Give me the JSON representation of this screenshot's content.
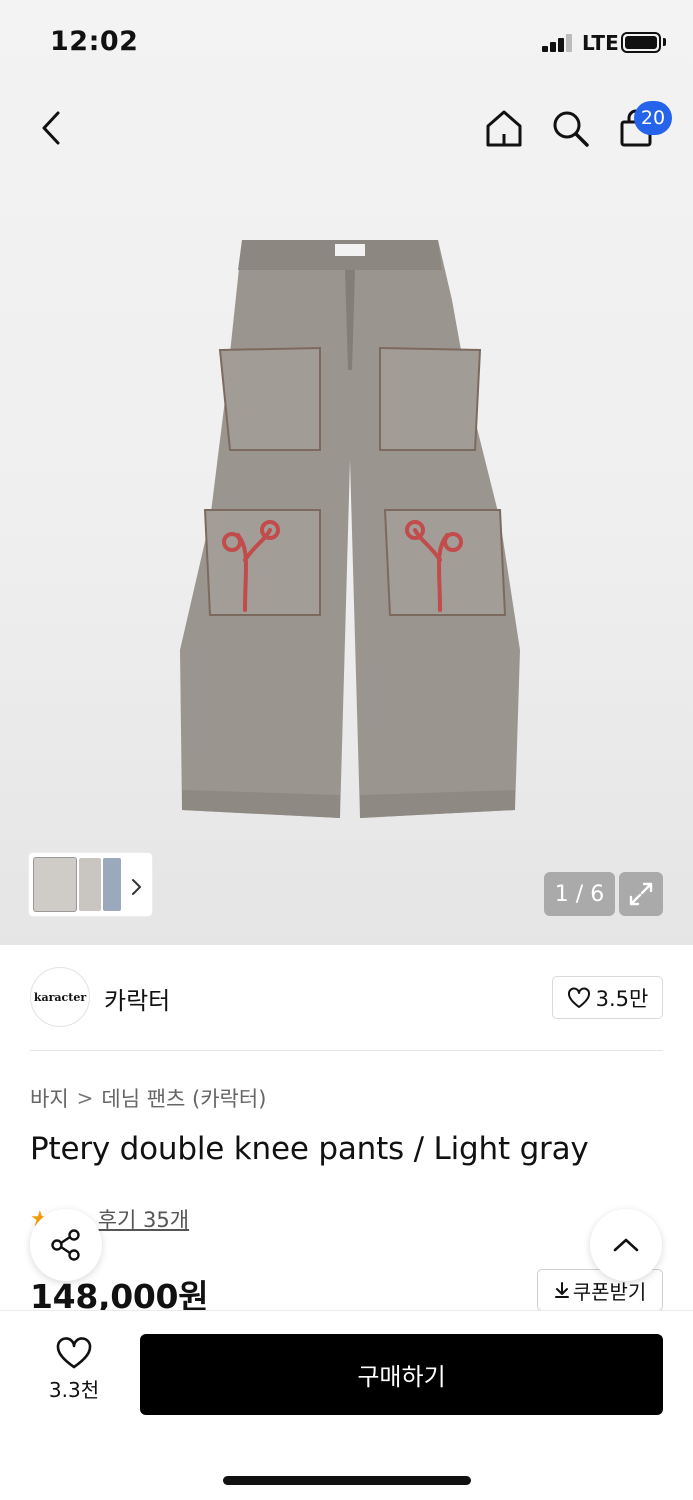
{
  "status_bar": {
    "time": "12:02",
    "network": "LTE"
  },
  "nav": {
    "cart_count": "20"
  },
  "gallery": {
    "counter": "1 / 6"
  },
  "brand": {
    "logo_text": "karacter",
    "name": "카락터",
    "like_count": "3.5만"
  },
  "breadcrumb": {
    "category": "바지",
    "separator": ">",
    "subcategory": "데님 팬츠 (카락터)"
  },
  "product": {
    "title": "Ptery double knee pants / Light gray",
    "review_link": "후기 35개",
    "price": "148,000원",
    "coupon_label": "쿠폰받기"
  },
  "bottom_bar": {
    "wish_count": "3.3천",
    "buy_label": "구매하기"
  },
  "colors": {
    "badge_blue": "#2563eb",
    "star": "#f59e0b",
    "buy_button": "#000000"
  }
}
